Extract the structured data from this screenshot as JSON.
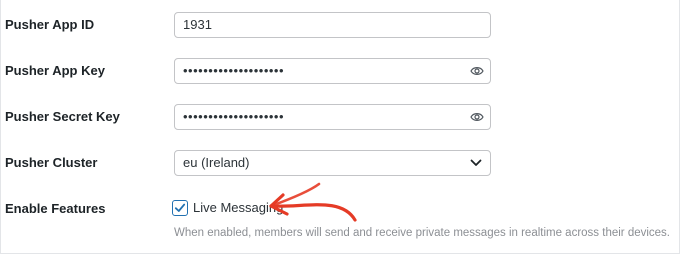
{
  "fields": {
    "app_id": {
      "label": "Pusher App ID",
      "value": "1931"
    },
    "app_key": {
      "label": "Pusher App Key",
      "masked_value": "••••••••••••••••••••"
    },
    "secret_key": {
      "label": "Pusher Secret Key",
      "masked_value": "••••••••••••••••••••"
    },
    "cluster": {
      "label": "Pusher Cluster",
      "selected": "eu (Ireland)"
    }
  },
  "features": {
    "label": "Enable Features",
    "live_messaging": {
      "label": "Live Messaging",
      "checked": true
    },
    "description": "When enabled, members will send and receive private messages in realtime across their devices."
  },
  "icons": {
    "reveal": "eye-icon",
    "dropdown": "chevron-down-icon",
    "check": "checkmark-icon",
    "annotation": "red-arrow-annotation"
  },
  "colors": {
    "accent": "#2271b1",
    "annotation": "#e53b26",
    "label": "#1d2327",
    "description": "#8c8f94"
  }
}
